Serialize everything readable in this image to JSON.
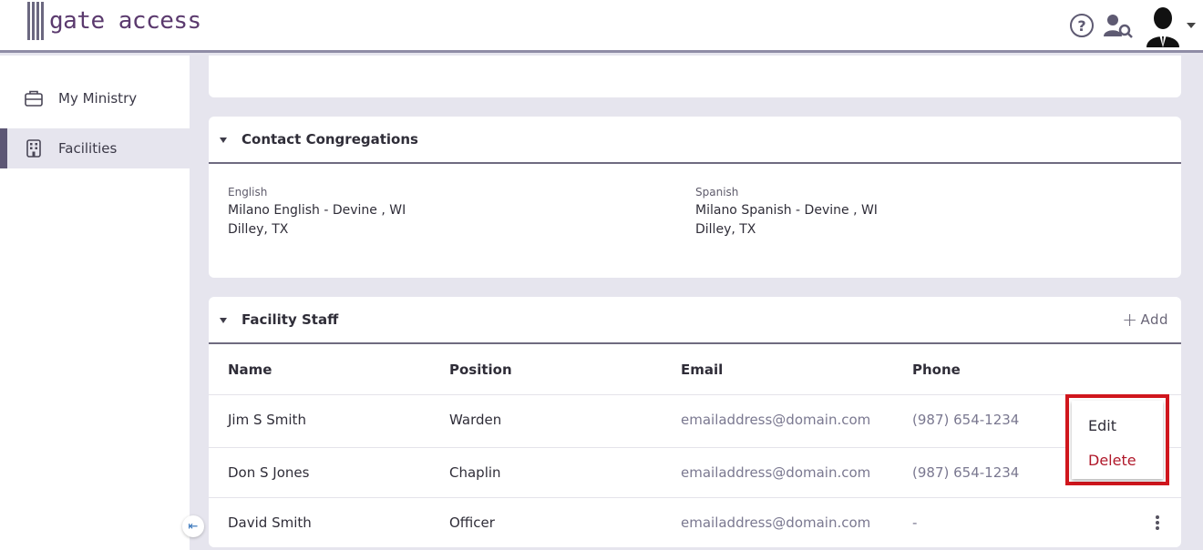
{
  "app": {
    "logo_text": "gate access"
  },
  "header": {
    "help_glyph": "?"
  },
  "sidebar": {
    "items": [
      {
        "label": "My Ministry",
        "icon": "briefcase-icon"
      },
      {
        "label": "Facilities",
        "icon": "building-icon",
        "active": true
      }
    ],
    "collapse_glyph": "⇤"
  },
  "congregations": {
    "title": "Contact Congregations",
    "entries": [
      {
        "language": "English",
        "name": "Milano English - Devine , WI",
        "location": "Dilley, TX"
      },
      {
        "language": "Spanish",
        "name": "Milano Spanish - Devine , WI",
        "location": "Dilley, TX"
      }
    ]
  },
  "staff": {
    "title": "Facility Staff",
    "add_plus": "+",
    "add_label": "Add",
    "columns": [
      "Name",
      "Position",
      "Email",
      "Phone"
    ],
    "rows": [
      {
        "name": "Jim S Smith",
        "position": "Warden",
        "email": "emailaddress@domain.com",
        "phone": "(987) 654-1234"
      },
      {
        "name": "Don S Jones",
        "position": "Chaplin",
        "email": "emailaddress@domain.com",
        "phone": "(987) 654-1234"
      },
      {
        "name": "David Smith",
        "position": "Officer",
        "email": "emailaddress@domain.com",
        "phone": "-"
      }
    ]
  },
  "context_menu": {
    "edit_label": "Edit",
    "delete_label": "Delete"
  },
  "colors": {
    "accent": "#5d5775",
    "highlight_border": "#d0161d",
    "delete": "#b0182a"
  }
}
